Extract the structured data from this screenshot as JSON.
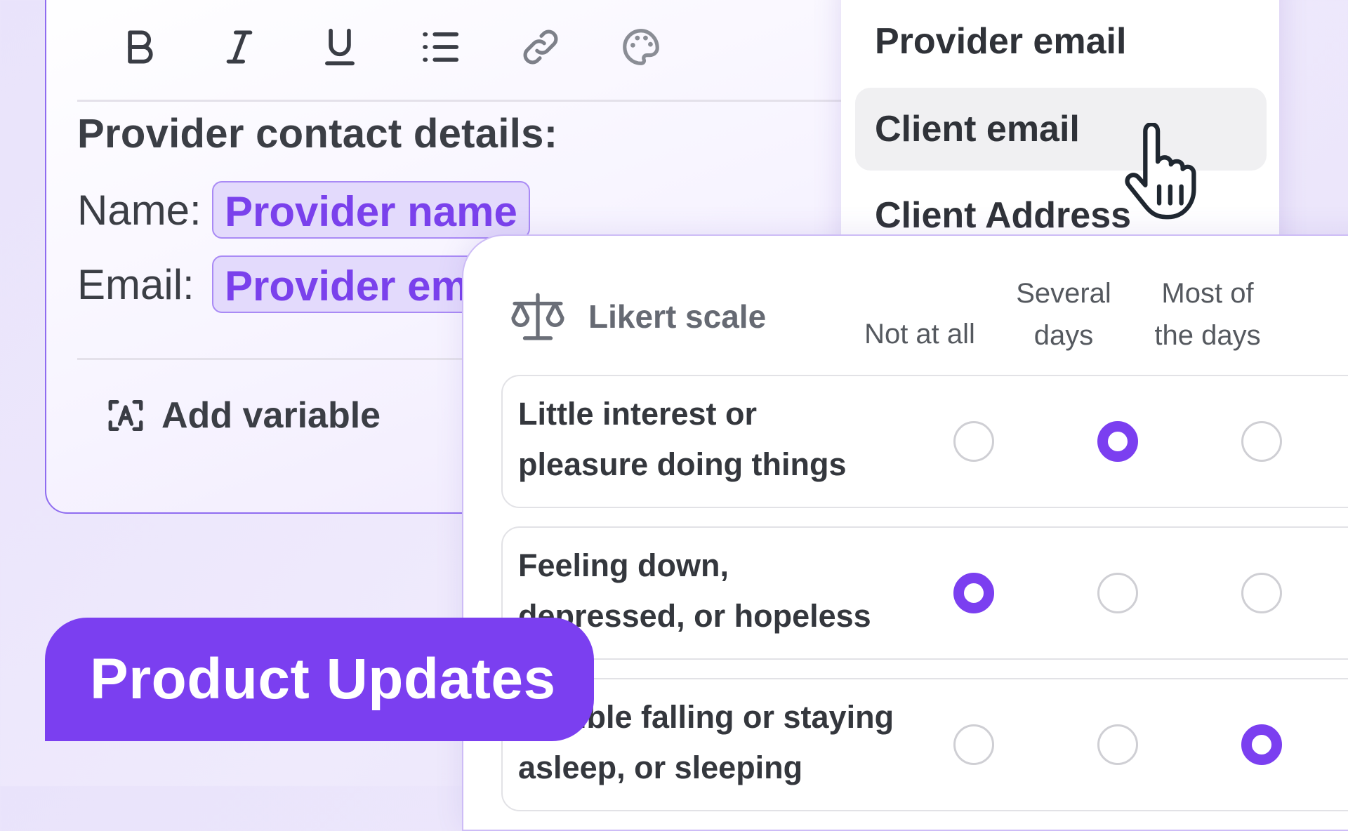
{
  "toolbar": {
    "bold_icon": "bold-icon",
    "italic_icon": "italic-icon",
    "underline_icon": "underline-icon",
    "list_icon": "bulleted-list-icon",
    "link_icon": "link-icon",
    "palette_icon": "palette-icon"
  },
  "editor": {
    "heading": "Provider contact details:",
    "fields": [
      {
        "label": "Name:",
        "chip": "Provider name"
      },
      {
        "label": "Email:",
        "chip": "Provider email"
      }
    ],
    "add_variable": "Add variable",
    "add_variable_icon": "variable-icon"
  },
  "dropdown": {
    "items": [
      "Provider email",
      "Client email",
      "Client Address"
    ],
    "hovered_index": 1
  },
  "likert": {
    "title": "Likert scale",
    "icon": "scale-icon",
    "columns": [
      [
        "Not at all"
      ],
      [
        "Several",
        "days"
      ],
      [
        "Most of",
        "the days"
      ]
    ],
    "questions": [
      {
        "lines": [
          "Little interest or",
          "pleasure doing things"
        ],
        "selected": 1
      },
      {
        "lines": [
          "Feeling down,",
          "depressed, or hopeless"
        ],
        "selected": 0
      },
      {
        "lines": [
          "Trouble falling or staying",
          "asleep, or sleeping"
        ],
        "selected": 2
      }
    ]
  },
  "banner": {
    "text": "Product Updates"
  },
  "colors": {
    "accent": "#7b3ff0",
    "chip_bg": "#e3dafc",
    "background": "#ece6fb"
  }
}
